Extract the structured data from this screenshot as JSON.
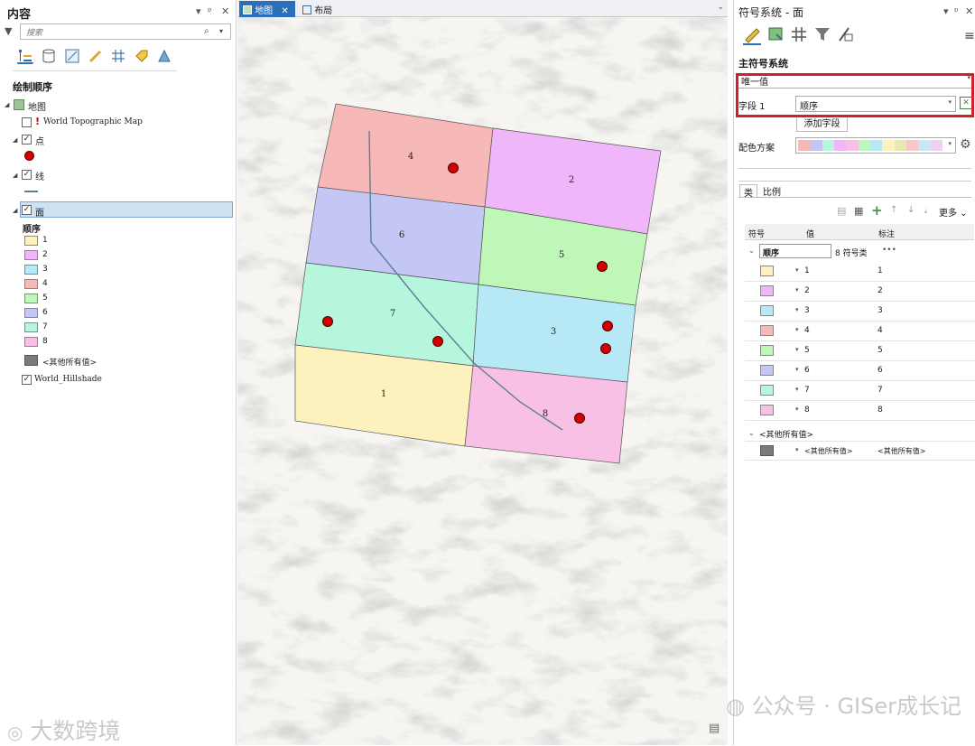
{
  "contents_pane": {
    "title": "内容",
    "search_placeholder": "搜索",
    "section_title": "绘制顺序",
    "map_label": "地图",
    "topo_layer": "World Topographic Map",
    "point_layer": "点",
    "line_layer": "线",
    "polygon_layer": "面",
    "legend_field": "顺序",
    "legend_items": [
      {
        "label": "1",
        "color": "#fdf1bd"
      },
      {
        "label": "2",
        "color": "#efb6f9"
      },
      {
        "label": "3",
        "color": "#b6e8f6"
      },
      {
        "label": "4",
        "color": "#f7b8b8"
      },
      {
        "label": "5",
        "color": "#bff7b9"
      },
      {
        "label": "6",
        "color": "#c4c6f4"
      },
      {
        "label": "7",
        "color": "#b5f6dd"
      },
      {
        "label": "8",
        "color": "#f8c0e5"
      }
    ],
    "other_label": "<其他所有值>",
    "other_color": "#7a7a7a",
    "hillshade_layer": "World_Hillshade"
  },
  "tabs": {
    "map_tab": "地图",
    "layout_tab": "布局"
  },
  "map": {
    "polygon_labels": [
      "4",
      "2",
      "6",
      "5",
      "7",
      "3",
      "1",
      "8"
    ],
    "point_color": "#d40000",
    "line_color": "#5b7f97"
  },
  "symbology": {
    "title": "符号系统 - 面",
    "primary_label": "主符号系统",
    "method_value": "唯一值",
    "field_label": "字段 1",
    "field_value": "顺序",
    "add_field_button": "添加字段",
    "color_scheme_label": "配色方案",
    "scheme_colors": [
      "#f7b8b8",
      "#c4c6f4",
      "#b5f6dd",
      "#efb6f9",
      "#f8c0e5",
      "#bff7b9",
      "#b6e8f6",
      "#fdf1bd",
      "#e8e8b0",
      "#f8c8c8",
      "#c8e8f8",
      "#f0d0f0"
    ],
    "tab_classes": "类",
    "tab_scales": "比例",
    "more_button": "更多",
    "col_symbol": "符号",
    "col_value": "值",
    "col_label": "标注",
    "group_name": "顺序",
    "group_count": "8 符号类",
    "group_more": "•••",
    "rows": [
      {
        "value": "1",
        "label": "1",
        "color": "#fdf1bd"
      },
      {
        "value": "2",
        "label": "2",
        "color": "#efb6f9"
      },
      {
        "value": "3",
        "label": "3",
        "color": "#b6e8f6"
      },
      {
        "value": "4",
        "label": "4",
        "color": "#f7b8b8"
      },
      {
        "value": "5",
        "label": "5",
        "color": "#bff7b9"
      },
      {
        "value": "6",
        "label": "6",
        "color": "#c4c6f4"
      },
      {
        "value": "7",
        "label": "7",
        "color": "#b5f6dd"
      },
      {
        "value": "8",
        "label": "8",
        "color": "#f8c0e5"
      }
    ],
    "other_group": "<其他所有值>",
    "other_value": "<其他所有值>",
    "other_label": "<其他所有值>",
    "other_color": "#7a7a7a"
  },
  "watermarks": {
    "left": "大数跨境",
    "right": "公众号 · GISer成长记"
  },
  "highlight_color": "#d21f2d"
}
